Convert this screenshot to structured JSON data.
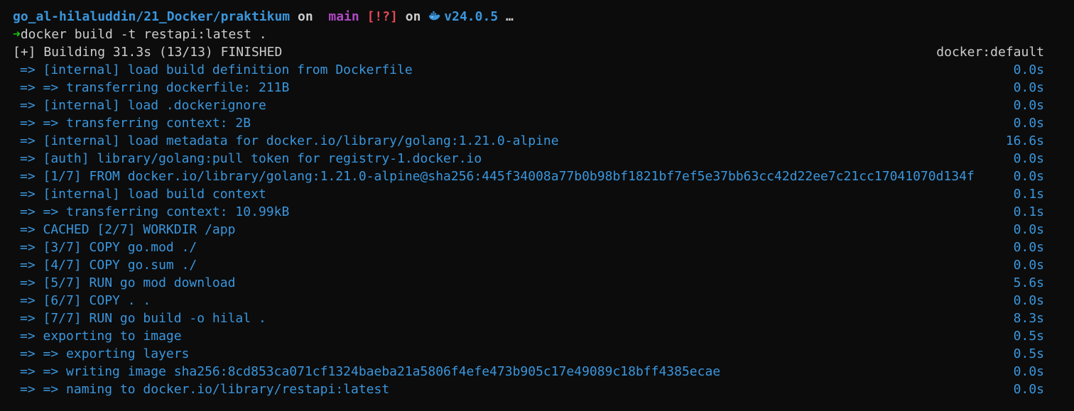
{
  "prompt": {
    "path": "go_al-hilaluddin/21_Docker/praktikum",
    "on1": "on",
    "branch_icon": "",
    "branch": "main",
    "git_status": "[!?]",
    "on2": "on",
    "docker_icon": "docker-whale-icon",
    "docker_version": "v24.0.5",
    "ellipsis": "…",
    "arrow": "➜",
    "command": "docker build -t restapi:latest ."
  },
  "summary": {
    "text": "[+] Building 31.3s (13/13) FINISHED",
    "builder": "docker:default"
  },
  "steps": [
    {
      "text": "=> [internal] load build definition from Dockerfile",
      "time": "0.0s"
    },
    {
      "text": "=> => transferring dockerfile: 211B",
      "time": "0.0s"
    },
    {
      "text": "=> [internal] load .dockerignore",
      "time": "0.0s"
    },
    {
      "text": "=> => transferring context: 2B",
      "time": "0.0s"
    },
    {
      "text": "=> [internal] load metadata for docker.io/library/golang:1.21.0-alpine",
      "time": "16.6s"
    },
    {
      "text": "=> [auth] library/golang:pull token for registry-1.docker.io",
      "time": "0.0s"
    },
    {
      "text": "=> [1/7] FROM docker.io/library/golang:1.21.0-alpine@sha256:445f34008a77b0b98bf1821bf7ef5e37bb63cc42d22ee7c21cc17041070d134f",
      "time": "0.0s"
    },
    {
      "text": "=> [internal] load build context",
      "time": "0.1s"
    },
    {
      "text": "=> => transferring context: 10.99kB",
      "time": "0.1s"
    },
    {
      "text": "=> CACHED [2/7] WORKDIR /app",
      "time": "0.0s"
    },
    {
      "text": "=> [3/7] COPY go.mod ./",
      "time": "0.0s"
    },
    {
      "text": "=> [4/7] COPY go.sum ./",
      "time": "0.0s"
    },
    {
      "text": "=> [5/7] RUN go mod download",
      "time": "5.6s"
    },
    {
      "text": "=> [6/7] COPY . .",
      "time": "0.0s"
    },
    {
      "text": "=> [7/7] RUN go build -o hilal .",
      "time": "8.3s"
    },
    {
      "text": "=> exporting to image",
      "time": "0.5s"
    },
    {
      "text": "=> => exporting layers",
      "time": "0.5s"
    },
    {
      "text": "=> => writing image sha256:8cd853ca071cf1324baeba21a5806f4efe473b905c17e49089c18bff4385ecae",
      "time": "0.0s"
    },
    {
      "text": "=> => naming to docker.io/library/restapi:latest",
      "time": "0.0s"
    }
  ]
}
